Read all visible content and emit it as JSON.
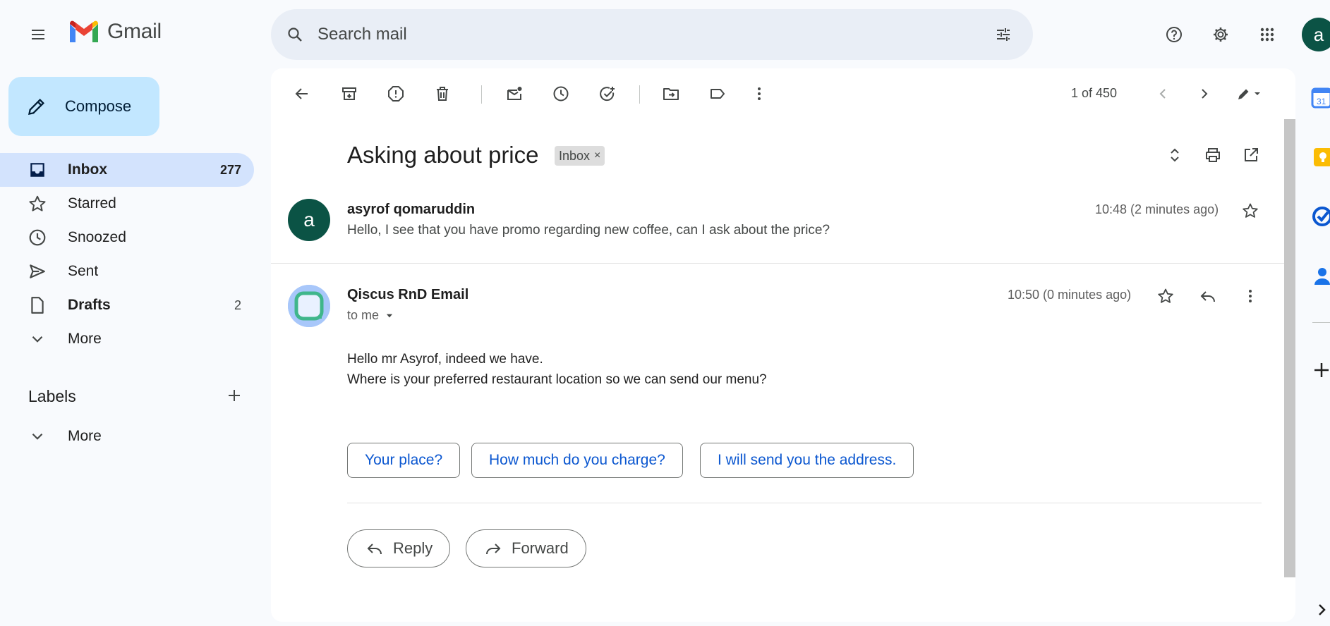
{
  "app": {
    "name": "Gmail"
  },
  "search": {
    "placeholder": "Search mail"
  },
  "header": {
    "account_initial": "a"
  },
  "sidebar": {
    "compose_label": "Compose",
    "items": [
      {
        "label": "Inbox",
        "count": "277",
        "icon": "inbox-icon",
        "active": true
      },
      {
        "label": "Starred",
        "count": "",
        "icon": "star-icon"
      },
      {
        "label": "Snoozed",
        "count": "",
        "icon": "clock-icon"
      },
      {
        "label": "Sent",
        "count": "",
        "icon": "send-icon"
      },
      {
        "label": "Drafts",
        "count": "2",
        "icon": "draft-icon"
      },
      {
        "label": "More",
        "count": "",
        "icon": "chevron-down-icon"
      }
    ],
    "labels_heading": "Labels",
    "labels_more": "More"
  },
  "toolbar": {
    "pager": "1 of 450"
  },
  "thread": {
    "subject": "Asking about price",
    "chip_label": "Inbox",
    "chip_close": "×",
    "messages": [
      {
        "sender": "asyrof qomaruddin",
        "avatar_initial": "a",
        "time": "10:48 (2 minutes ago)",
        "snippet": "Hello, I see that you have promo regarding new coffee, can I ask about the price?"
      },
      {
        "sender": "Qiscus RnD Email",
        "time": "10:50 (0 minutes ago)",
        "recipient": "to me",
        "body": [
          "Hello mr Asyrof, indeed we have.",
          "Where is your preferred restaurant location so we can send our menu?"
        ]
      }
    ],
    "smart_replies": [
      "Your place?",
      "How much do you charge?",
      "I will send you the address."
    ],
    "reply_label": "Reply",
    "forward_label": "Forward"
  },
  "colors": {
    "accent": "#0b57d0",
    "compose_bg": "#c2e7ff",
    "active_nav": "#d3e3fd",
    "avatar_bg": "#0b5345"
  }
}
